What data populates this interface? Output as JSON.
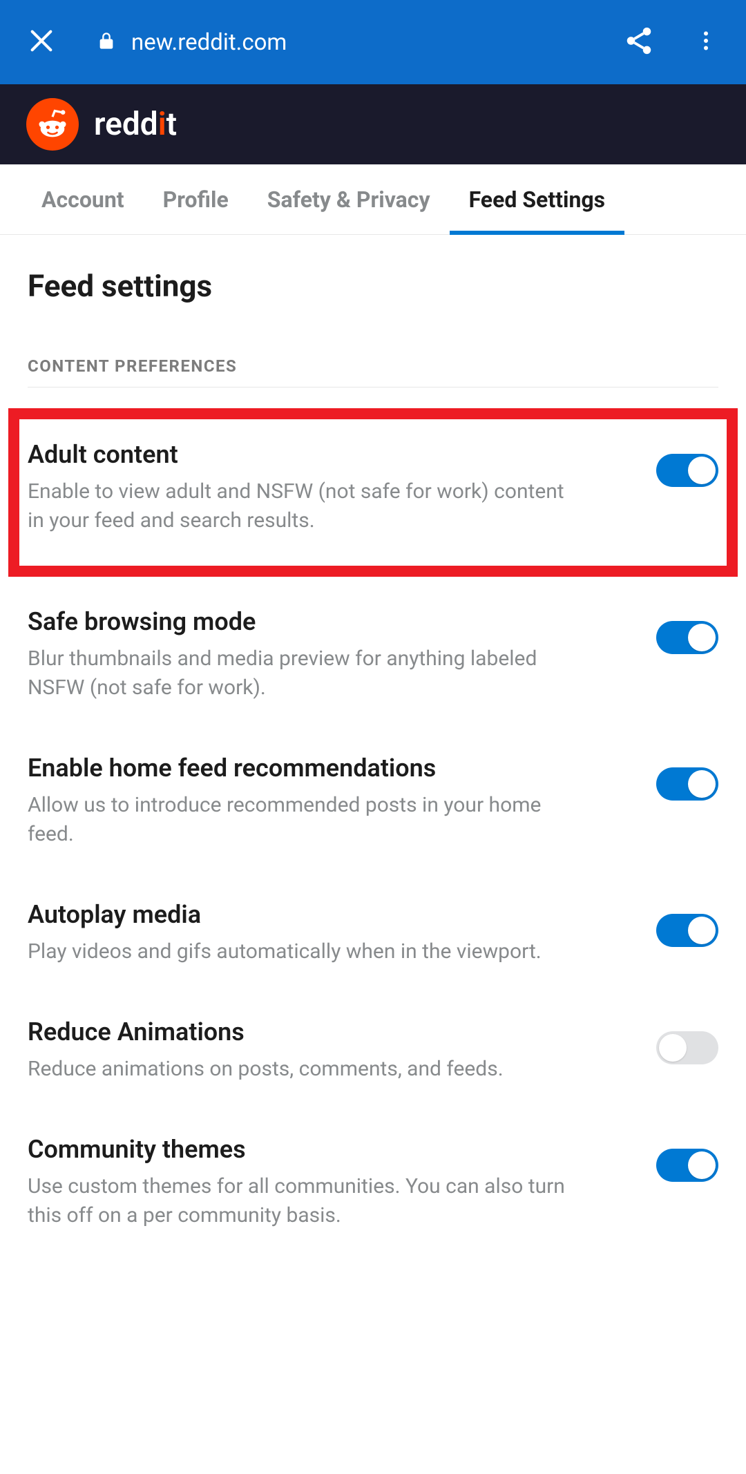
{
  "browser": {
    "url": "new.reddit.com"
  },
  "brand": {
    "wordmark_prefix": "redd",
    "wordmark_suffix": "t"
  },
  "tabs": {
    "account": "Account",
    "profile": "Profile",
    "safety": "Safety & Privacy",
    "feed": "Feed Settings"
  },
  "page": {
    "title": "Feed settings",
    "section_label": "CONTENT PREFERENCES"
  },
  "settings": {
    "adult": {
      "title": "Adult content",
      "desc": "Enable to view adult and NSFW (not safe for work) content in your feed and search results.",
      "on": true
    },
    "safe": {
      "title": "Safe browsing mode",
      "desc": "Blur thumbnails and media preview for anything labeled NSFW (not safe for work).",
      "on": true
    },
    "recs": {
      "title": "Enable home feed recommendations",
      "desc": "Allow us to introduce recommended posts in your home feed.",
      "on": true
    },
    "autoplay": {
      "title": "Autoplay media",
      "desc": "Play videos and gifs automatically when in the viewport.",
      "on": true
    },
    "reduce": {
      "title": "Reduce Animations",
      "desc": "Reduce animations on posts, comments, and feeds.",
      "on": false
    },
    "themes": {
      "title": "Community themes",
      "desc": "Use custom themes for all communities. You can also turn this off on a per community basis.",
      "on": true
    }
  }
}
